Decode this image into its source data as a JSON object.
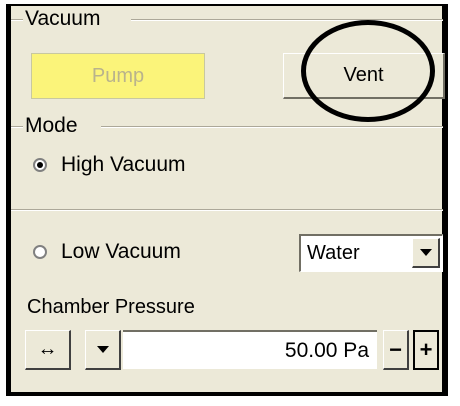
{
  "vacuum": {
    "title": "Vacuum",
    "pump_label": "Pump",
    "vent_label": "Vent"
  },
  "mode": {
    "title": "Mode",
    "high_vacuum_label": "High Vacuum",
    "high_vacuum_selected": true,
    "low_vacuum_label": "Low Vacuum",
    "low_vacuum_selected": false,
    "gas_selected": "Water"
  },
  "chamber": {
    "title": "Chamber Pressure",
    "value": "50.00 Pa",
    "range_icon": "↔",
    "minus_label": "−",
    "plus_label": "+"
  },
  "colors": {
    "panel_bg": "#ece9d8",
    "pump_bg": "#fbf47a",
    "annotation": "#000000"
  }
}
